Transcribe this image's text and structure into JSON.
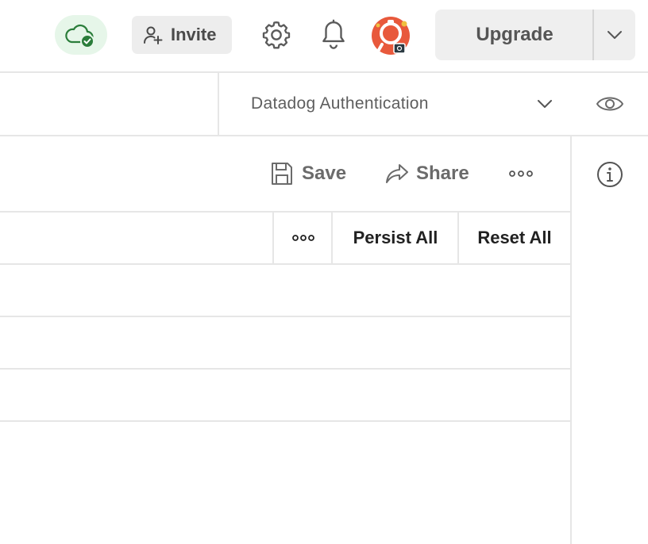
{
  "header": {
    "sync_status": "synced",
    "invite_label": "Invite",
    "upgrade_label": "Upgrade",
    "icons": [
      "cloud-check-icon",
      "add-user-icon",
      "gear-icon",
      "bell-icon",
      "avatar",
      "chevron-down-icon"
    ]
  },
  "environment": {
    "selected": "Datadog Authentication",
    "icons": [
      "chevron-down-icon",
      "eye-icon"
    ]
  },
  "toolbar": {
    "save_label": "Save",
    "share_label": "Share",
    "icons": [
      "save-icon",
      "share-icon",
      "more-horizontal-icon",
      "info-icon"
    ]
  },
  "table": {
    "actions": [
      "Persist All",
      "Reset All"
    ],
    "rows": [
      {},
      {},
      {}
    ]
  },
  "colors": {
    "sync_bg": "#e6f6e9",
    "sync_green": "#2a7d3a",
    "avatar_orange": "#e8593c",
    "button_gray": "#efefef",
    "border": "#e6e6e6"
  }
}
